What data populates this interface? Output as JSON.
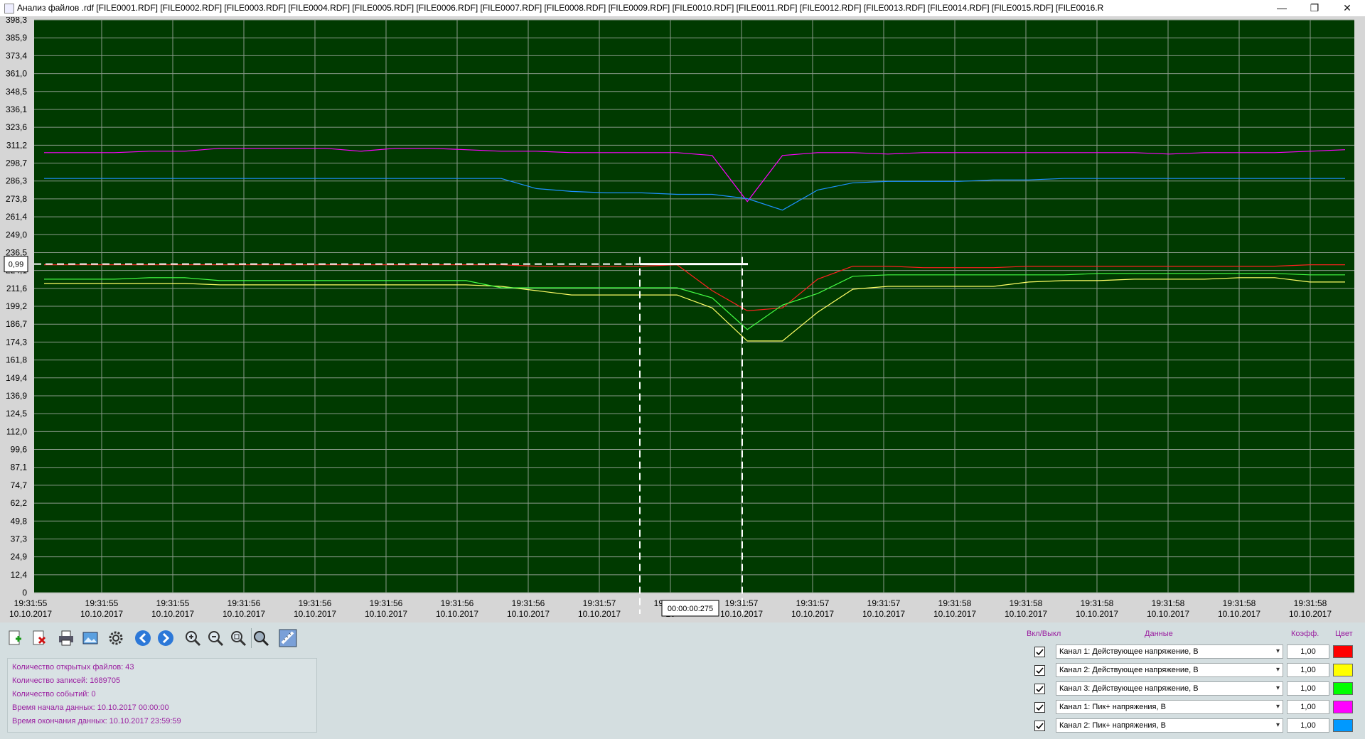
{
  "window": {
    "title": "Анализ файлов .rdf [FILE0001.RDF] [FILE0002.RDF] [FILE0003.RDF] [FILE0004.RDF] [FILE0005.RDF] [FILE0006.RDF] [FILE0007.RDF] [FILE0008.RDF] [FILE0009.RDF] [FILE0010.RDF] [FILE0011.RDF] [FILE0012.RDF] [FILE0013.RDF] [FILE0014.RDF] [FILE0015.RDF] [FILE0016.R",
    "minimize": "—",
    "maximize": "❐",
    "close": "✕"
  },
  "chart": {
    "y_ticks": [
      "0",
      "12,4",
      "24,9",
      "37,3",
      "49,8",
      "62,2",
      "74,7",
      "87,1",
      "99,6",
      "112,0",
      "124,5",
      "136,9",
      "149,4",
      "161,8",
      "174,3",
      "186,7",
      "199,2",
      "211,6",
      "224,1",
      "236,5",
      "249,0",
      "261,4",
      "273,8",
      "286,3",
      "298,7",
      "311,2",
      "323,6",
      "336,1",
      "348,5",
      "361,0",
      "373,4",
      "385,9",
      "398,3"
    ],
    "x_ticks": [
      {
        "time": "19:31:55",
        "date": "10.10.2017"
      },
      {
        "time": "19:31:55",
        "date": "10.10.2017"
      },
      {
        "time": "19:31:55",
        "date": "10.10.2017"
      },
      {
        "time": "19:31:56",
        "date": "10.10.2017"
      },
      {
        "time": "19:31:56",
        "date": "10.10.2017"
      },
      {
        "time": "19:31:56",
        "date": "10.10.2017"
      },
      {
        "time": "19:31:56",
        "date": "10.10.2017"
      },
      {
        "time": "19:31:56",
        "date": "10.10.2017"
      },
      {
        "time": "19:31:57",
        "date": "10.10.2017"
      },
      {
        "time": "19:31:57",
        "date": "10"
      },
      {
        "time": "19:31:57",
        "date": "10.10.2017"
      },
      {
        "time": "19:31:57",
        "date": "10.10.2017"
      },
      {
        "time": "19:31:57",
        "date": "10.10.2017"
      },
      {
        "time": "19:31:58",
        "date": "10.10.2017"
      },
      {
        "time": "19:31:58",
        "date": "10.10.2017"
      },
      {
        "time": "19:31:58",
        "date": "10.10.2017"
      },
      {
        "time": "19:31:58",
        "date": "10.10.2017"
      },
      {
        "time": "19:31:58",
        "date": "10.10.2017"
      },
      {
        "time": "19:31:58",
        "date": "10.10.2017"
      }
    ],
    "cursor_value": "0,99",
    "interval_label": "00:00:00:275",
    "colors": {
      "background": "#003a00",
      "grid": "#8a9a8a",
      "cursor": "#ffffff"
    }
  },
  "chart_data": {
    "type": "line",
    "ylim": [
      0,
      398.3
    ],
    "x": [
      0,
      1,
      2,
      3,
      4,
      5,
      6,
      7,
      8,
      9,
      10,
      11,
      12,
      13,
      14,
      15,
      16,
      17,
      18,
      19,
      20,
      21,
      22,
      23,
      24,
      25,
      26,
      27,
      28,
      29,
      30,
      31,
      32,
      33,
      34,
      35,
      36,
      37
    ],
    "series": [
      {
        "color": "#ff2020",
        "values": [
          228,
          228,
          228,
          228,
          228,
          228,
          228,
          228,
          228,
          228,
          228,
          228,
          228,
          228,
          227,
          227,
          227,
          227,
          228,
          210,
          196,
          198,
          218,
          227,
          227,
          226,
          226,
          226,
          227,
          227,
          227,
          227,
          227,
          227,
          227,
          227,
          228,
          228
        ]
      },
      {
        "color": "#ffff66",
        "values": [
          215,
          215,
          215,
          215,
          215,
          214,
          214,
          214,
          214,
          214,
          214,
          214,
          214,
          213,
          210,
          207,
          207,
          207,
          207,
          198,
          175,
          175,
          195,
          211,
          213,
          213,
          213,
          213,
          216,
          217,
          217,
          218,
          218,
          218,
          219,
          219,
          216,
          216
        ]
      },
      {
        "color": "#44ff44",
        "values": [
          218,
          218,
          218,
          219,
          219,
          217,
          217,
          217,
          217,
          217,
          217,
          217,
          217,
          212,
          212,
          212,
          212,
          212,
          212,
          205,
          183,
          200,
          208,
          220,
          221,
          221,
          221,
          221,
          221,
          221,
          222,
          222,
          222,
          222,
          222,
          222,
          221,
          221
        ]
      },
      {
        "color": "#ff00ff",
        "values": [
          306,
          306,
          306,
          307,
          307,
          309,
          309,
          309,
          309,
          307,
          309,
          309,
          308,
          307,
          307,
          306,
          306,
          306,
          306,
          304,
          272,
          304,
          306,
          306,
          305,
          306,
          306,
          306,
          306,
          306,
          306,
          306,
          305,
          306,
          306,
          306,
          307,
          308
        ]
      },
      {
        "color": "#1e90ff",
        "values": [
          288,
          288,
          288,
          288,
          288,
          288,
          288,
          288,
          288,
          288,
          288,
          288,
          288,
          288,
          281,
          279,
          278,
          278,
          277,
          277,
          274,
          266,
          280,
          285,
          286,
          286,
          286,
          287,
          287,
          288,
          288,
          288,
          288,
          288,
          288,
          288,
          288,
          288
        ]
      }
    ]
  },
  "toolbar": {
    "items": [
      {
        "name": "add-file-button",
        "icon": "add-file-icon"
      },
      {
        "name": "delete-file-button",
        "icon": "delete-file-icon"
      },
      {
        "name": "print-button",
        "icon": "print-icon"
      },
      {
        "name": "export-image-button",
        "icon": "image-icon"
      },
      {
        "name": "settings-button",
        "icon": "gear-icon"
      },
      {
        "name": "back-button",
        "icon": "arrow-left-icon"
      },
      {
        "name": "forward-button",
        "icon": "arrow-right-icon"
      },
      {
        "name": "zoom-in-button",
        "icon": "zoom-in-icon"
      },
      {
        "name": "zoom-out-button",
        "icon": "zoom-out-icon"
      },
      {
        "name": "zoom-area-button",
        "icon": "zoom-area-icon"
      },
      {
        "name": "zoom-fit-button",
        "icon": "zoom-fit-icon"
      },
      {
        "name": "measure-button",
        "icon": "ruler-icon"
      }
    ]
  },
  "info": {
    "open_files": "Количество открытых файлов: 43",
    "records": "Количество записей: 1689705",
    "events": "Количество событий: 0",
    "start_time": "Время начала данных: 10.10.2017 00:00:00",
    "end_time": "Время окончания данных: 10.10.2017 23:59:59"
  },
  "channels": {
    "header_toggle": "Вкл/Выкл",
    "header_data": "Данные",
    "header_coef": "Коэфф.",
    "header_color": "Цвет",
    "rows": [
      {
        "label": "Канал 1: Действующее напряжение, В",
        "coef": "1,00",
        "color": "#ff0000"
      },
      {
        "label": "Канал 2: Действующее напряжение, В",
        "coef": "1,00",
        "color": "#ffff00"
      },
      {
        "label": "Канал 3: Действующее напряжение, В",
        "coef": "1,00",
        "color": "#00ff00"
      },
      {
        "label": "Канал 1: Пик+ напряжения, В",
        "coef": "1,00",
        "color": "#ff00ff"
      },
      {
        "label": "Канал 2: Пик+ напряжения, В",
        "coef": "1,00",
        "color": "#0099ff"
      }
    ]
  }
}
